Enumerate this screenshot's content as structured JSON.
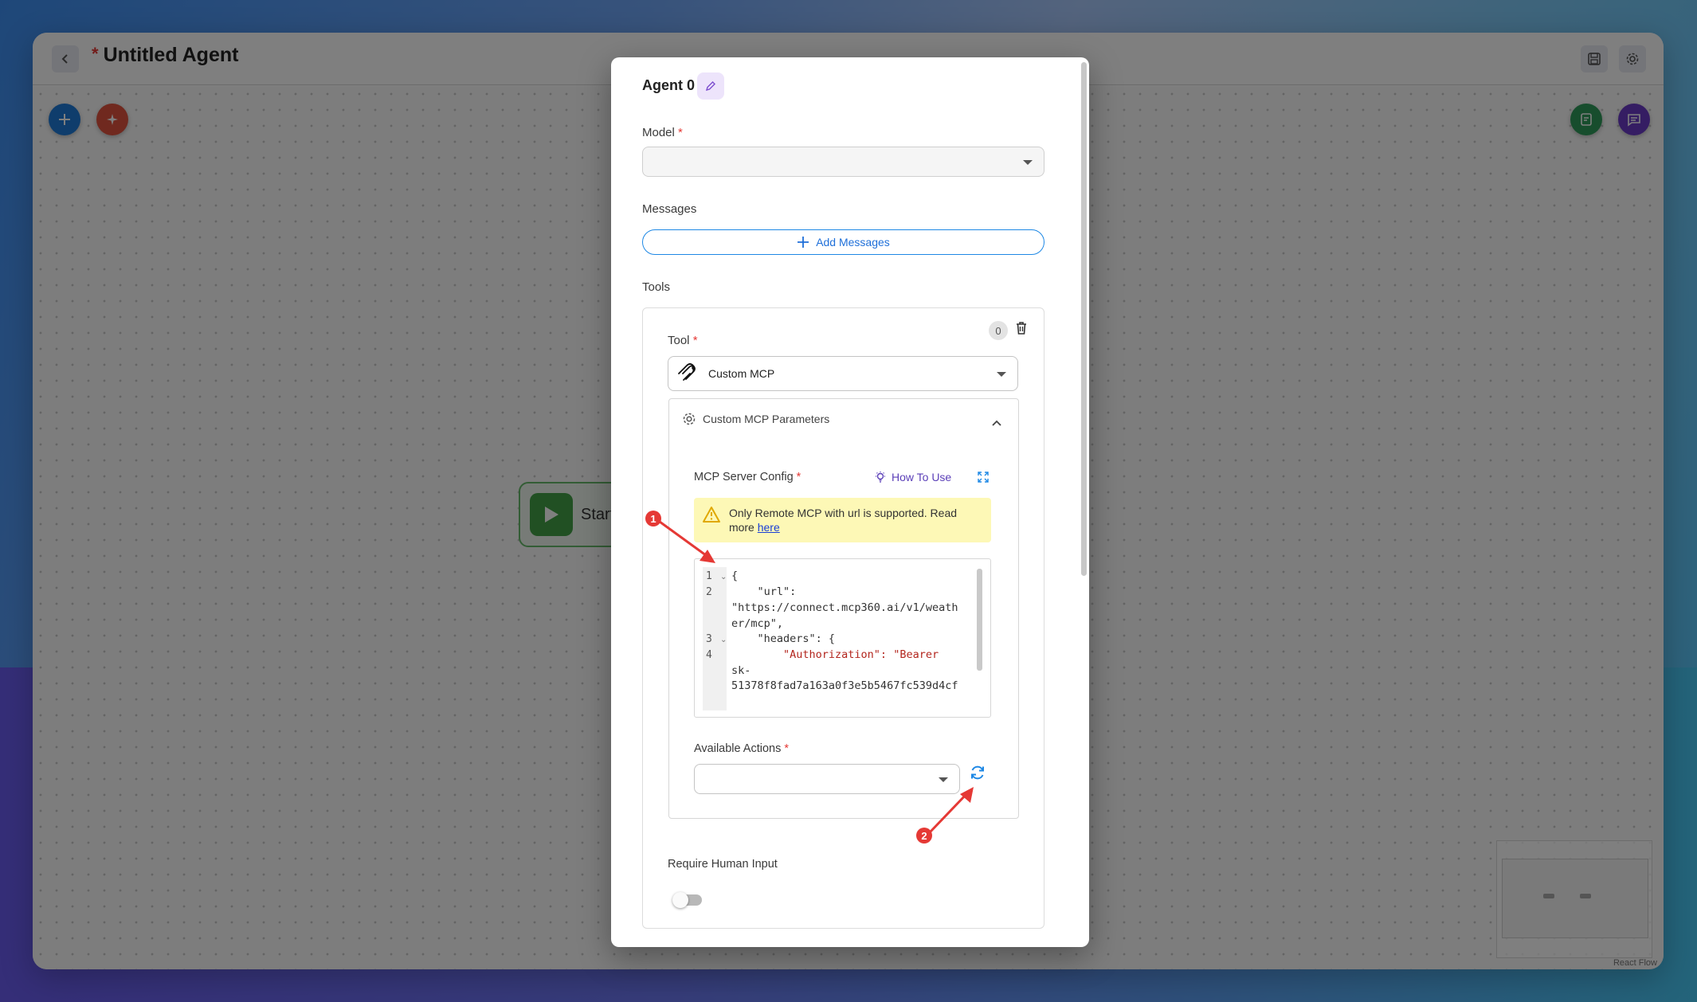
{
  "app": {
    "title_marker": "*",
    "title": "Untitled Agent"
  },
  "canvas": {
    "start_node_label": "Start",
    "attribution": "React Flow"
  },
  "dialog": {
    "agent_name": "Agent 0",
    "model": {
      "label": "Model",
      "required_mark": "*",
      "value": ""
    },
    "messages": {
      "label": "Messages",
      "add_button_label": "Add Messages"
    },
    "tools": {
      "label": "Tools",
      "index_badge": "0",
      "tool": {
        "label": "Tool",
        "required_mark": "*",
        "value": "Custom MCP"
      },
      "params": {
        "title": "Custom MCP Parameters",
        "server_config": {
          "label": "MCP Server Config",
          "required_mark": "*",
          "how_to_use": "How To Use",
          "warning_text": "Only Remote MCP with url is supported. Read more ",
          "warning_link": "here",
          "code_line_numbers": [
            "1",
            "2",
            "3",
            "4"
          ],
          "code": {
            "line1": "{",
            "line2_key": "    \"url\":",
            "line2_value_a": "\"https://connect.mcp360.ai/v1/weath",
            "line2_value_b": "er/mcp\",",
            "line3": "    \"headers\": {",
            "line4_key": "        \"Authorization\": ",
            "line4_value_a": "\"Bearer",
            "line4_value_b": "sk-",
            "line4_value_c": "51378f8fad7a163a0f3e5b5467fc539d4cf"
          }
        },
        "available_actions": {
          "label": "Available Actions",
          "required_mark": "*",
          "value": ""
        }
      },
      "require_human_input": {
        "label": "Require Human Input",
        "enabled": false
      }
    }
  },
  "annotations": {
    "marker1": "1",
    "marker2": "2"
  },
  "colors": {
    "accent_blue": "#1e88e5",
    "annotation_red": "#e53935",
    "start_green": "#43a047",
    "link_purple": "#5b3fb8"
  }
}
